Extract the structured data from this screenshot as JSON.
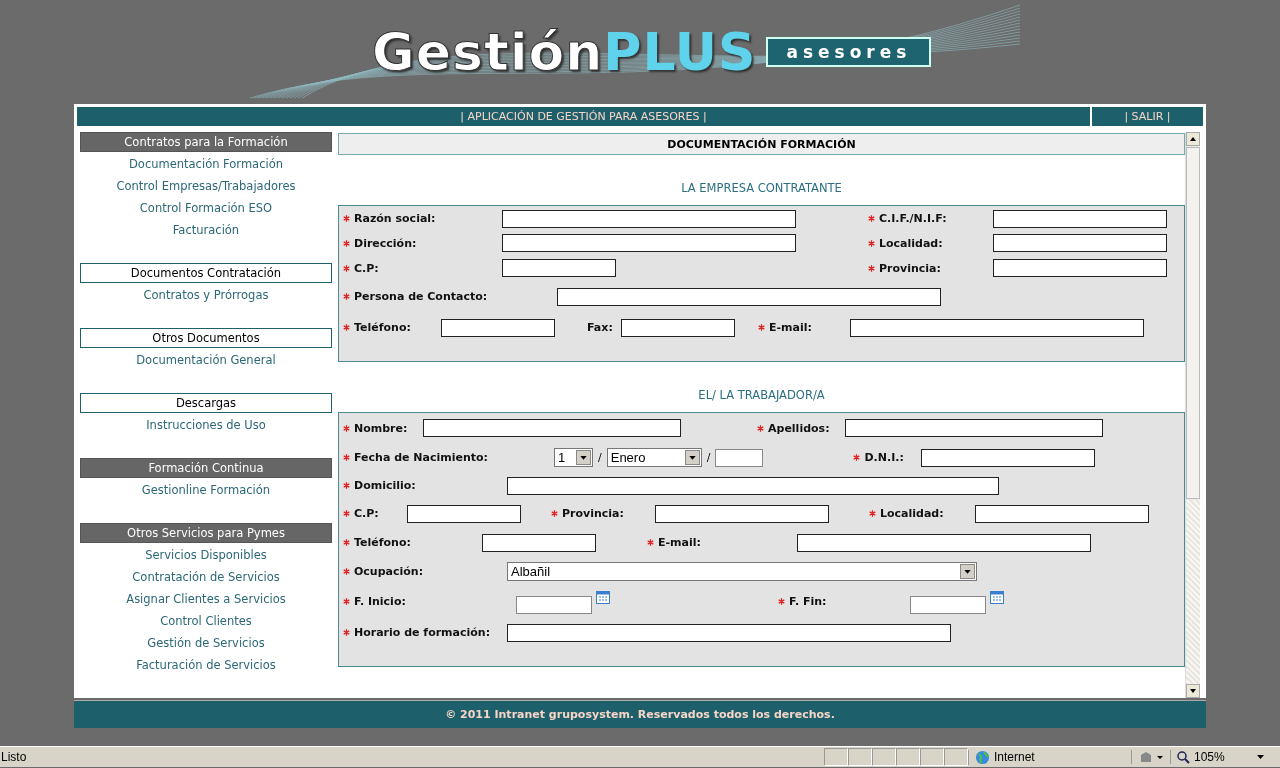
{
  "header": {
    "logo": {
      "word": "Gestión",
      "accent": "PLUS",
      "badge": "asesores"
    }
  },
  "top_bar": {
    "title": "| APLICACIÓN DE GESTIÓN PARA ASESORES |",
    "logout": "| SALIR |"
  },
  "sidebar": {
    "sections": [
      {
        "title": "Contratos para la Formación",
        "kind": "filled",
        "items": [
          "Documentación Formación",
          "Control Empresas/Trabajadores",
          "Control Formación ESO",
          "Facturación"
        ]
      },
      {
        "title": "Documentos Contratación",
        "kind": "outlined",
        "items": [
          "Contratos y Prórrogas"
        ]
      },
      {
        "title": "Otros Documentos",
        "kind": "outlined",
        "items": [
          "Documentación General"
        ]
      },
      {
        "title": "Descargas",
        "kind": "outlined",
        "items": [
          "Instrucciones de Uso"
        ]
      },
      {
        "title": "Formación Continua",
        "kind": "filled",
        "items": [
          "Gestionline Formación"
        ]
      },
      {
        "title": "Otros Servicios para Pymes",
        "kind": "filled",
        "items": [
          "Servicios Disponibles",
          "Contratación de Servicios",
          "Asignar Clientes a Servicios",
          "Control Clientes",
          "Gestión de Servicios",
          "Facturación de Servicios"
        ]
      }
    ]
  },
  "main": {
    "title": "DOCUMENTACIÓN FORMACIÓN",
    "sections": [
      {
        "title": "LA EMPRESA CONTRATANTE",
        "rows": [
          [
            {
              "label": "Razón social:",
              "required": true,
              "kind": "text"
            },
            {
              "label": "C.I.F./N.I.F:",
              "required": true,
              "kind": "text"
            }
          ],
          [
            {
              "label": "Dirección:",
              "required": true,
              "kind": "text"
            },
            {
              "label": "Localidad:",
              "required": true,
              "kind": "text"
            }
          ],
          [
            {
              "label": "C.P:",
              "required": true,
              "kind": "text"
            },
            {
              "label": "Provincia:",
              "required": true,
              "kind": "text"
            }
          ],
          [
            {
              "label": "Persona de Contacto:",
              "required": true,
              "kind": "text"
            }
          ],
          [
            {
              "label": "Teléfono:",
              "required": true,
              "kind": "text"
            },
            {
              "label": "Fax:",
              "required": false,
              "kind": "text"
            },
            {
              "label": "E-mail:",
              "required": true,
              "kind": "text"
            }
          ]
        ]
      },
      {
        "title": "EL/ LA TRABAJADOR/A",
        "rows": [
          [
            {
              "label": "Nombre:",
              "required": true,
              "kind": "text"
            },
            {
              "label": "Apellidos:",
              "required": true,
              "kind": "text"
            }
          ],
          [
            {
              "label": "Fecha de Nacimiento:",
              "required": true,
              "kind": "birthdate",
              "day": "1",
              "month": "Enero",
              "separators": [
                "/",
                "/"
              ]
            },
            {
              "label": "D.N.I.:",
              "required": true,
              "kind": "text"
            }
          ],
          [
            {
              "label": "Domicilio:",
              "required": true,
              "kind": "text"
            }
          ],
          [
            {
              "label": "C.P:",
              "required": true,
              "kind": "text"
            },
            {
              "label": "Provincia:",
              "required": true,
              "kind": "text"
            },
            {
              "label": "Localidad:",
              "required": true,
              "kind": "text"
            }
          ],
          [
            {
              "label": "Teléfono:",
              "required": true,
              "kind": "text"
            },
            {
              "label": "E-mail:",
              "required": true,
              "kind": "text"
            }
          ],
          [
            {
              "label": "Ocupación:",
              "required": true,
              "kind": "select",
              "value": "Albañil"
            }
          ],
          [
            {
              "label": "F. Inicio:",
              "required": true,
              "kind": "date"
            },
            {
              "label": "F. Fin:",
              "required": true,
              "kind": "date"
            }
          ],
          [
            {
              "label": "Horario de formación:",
              "required": true,
              "kind": "text"
            }
          ]
        ]
      }
    ]
  },
  "footer": {
    "text": "© 2011 Intranet gruposystem. Reservados todos los derechos."
  },
  "status_bar": {
    "status": "Listo",
    "zone": "Internet",
    "zoom": "105%"
  }
}
